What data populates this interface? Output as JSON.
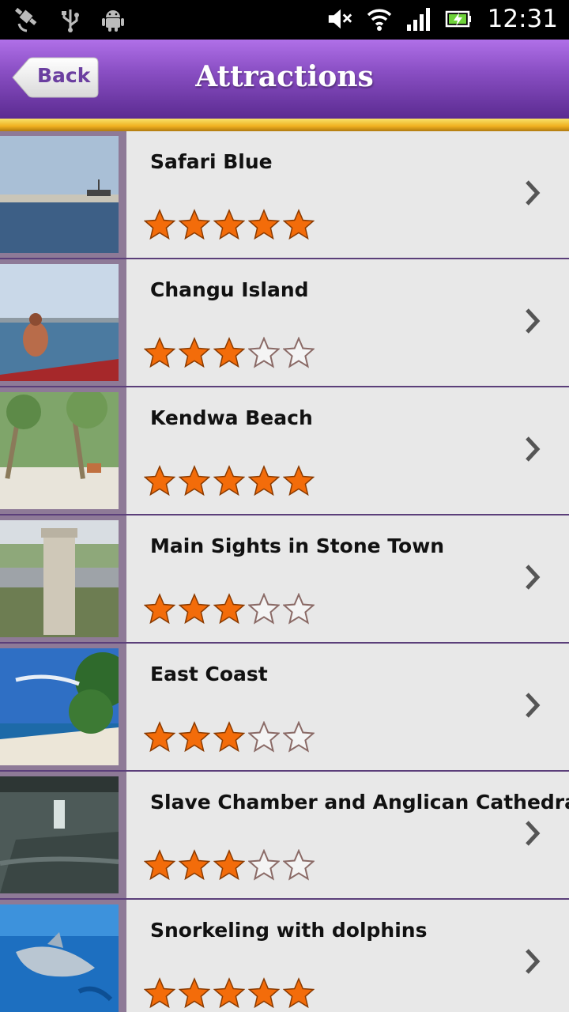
{
  "status_bar": {
    "time": "12:31",
    "left_icons": [
      "gps-icon",
      "usb-icon",
      "android-icon"
    ],
    "right_icons": [
      "mute-icon",
      "wifi-icon",
      "signal-icon",
      "battery-charging-icon"
    ]
  },
  "header": {
    "back_label": "Back",
    "title": "Attractions"
  },
  "colors": {
    "header_purple": "#8a4fc4",
    "accent_gold": "#f0b020",
    "star_filled": "#f36c0a"
  },
  "attractions": [
    {
      "name": "Safari Blue",
      "rating": 5,
      "max_rating": 5
    },
    {
      "name": "Changu Island",
      "rating": 3,
      "max_rating": 5
    },
    {
      "name": "Kendwa Beach",
      "rating": 5,
      "max_rating": 5
    },
    {
      "name": "Main Sights in Stone Town",
      "rating": 3,
      "max_rating": 5
    },
    {
      "name": "East Coast",
      "rating": 3,
      "max_rating": 5
    },
    {
      "name": "Slave Chamber and Anglican Cathedral",
      "rating": 3,
      "max_rating": 5
    },
    {
      "name": "Snorkeling with dolphins",
      "rating": 5,
      "max_rating": 5
    }
  ]
}
